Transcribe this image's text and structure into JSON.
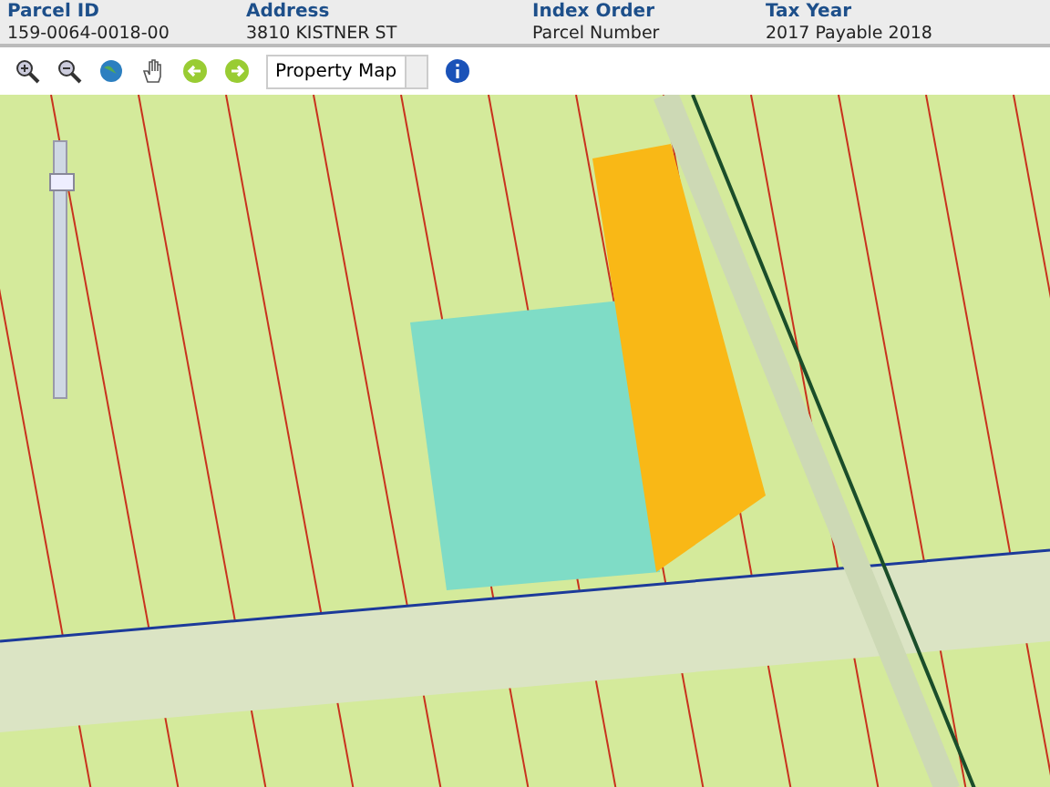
{
  "header": [
    {
      "label": "Parcel ID",
      "value": "159-0064-0018-00"
    },
    {
      "label": "Address",
      "value": "3810 KISTNER ST"
    },
    {
      "label": "Index Order",
      "value": "Parcel Number"
    },
    {
      "label": "Tax Year",
      "value": "2017 Payable 2018"
    }
  ],
  "toolbar": {
    "layer_select": {
      "value": "Property Map"
    }
  },
  "map": {
    "zoom_slider": {
      "level": 0.87
    }
  }
}
